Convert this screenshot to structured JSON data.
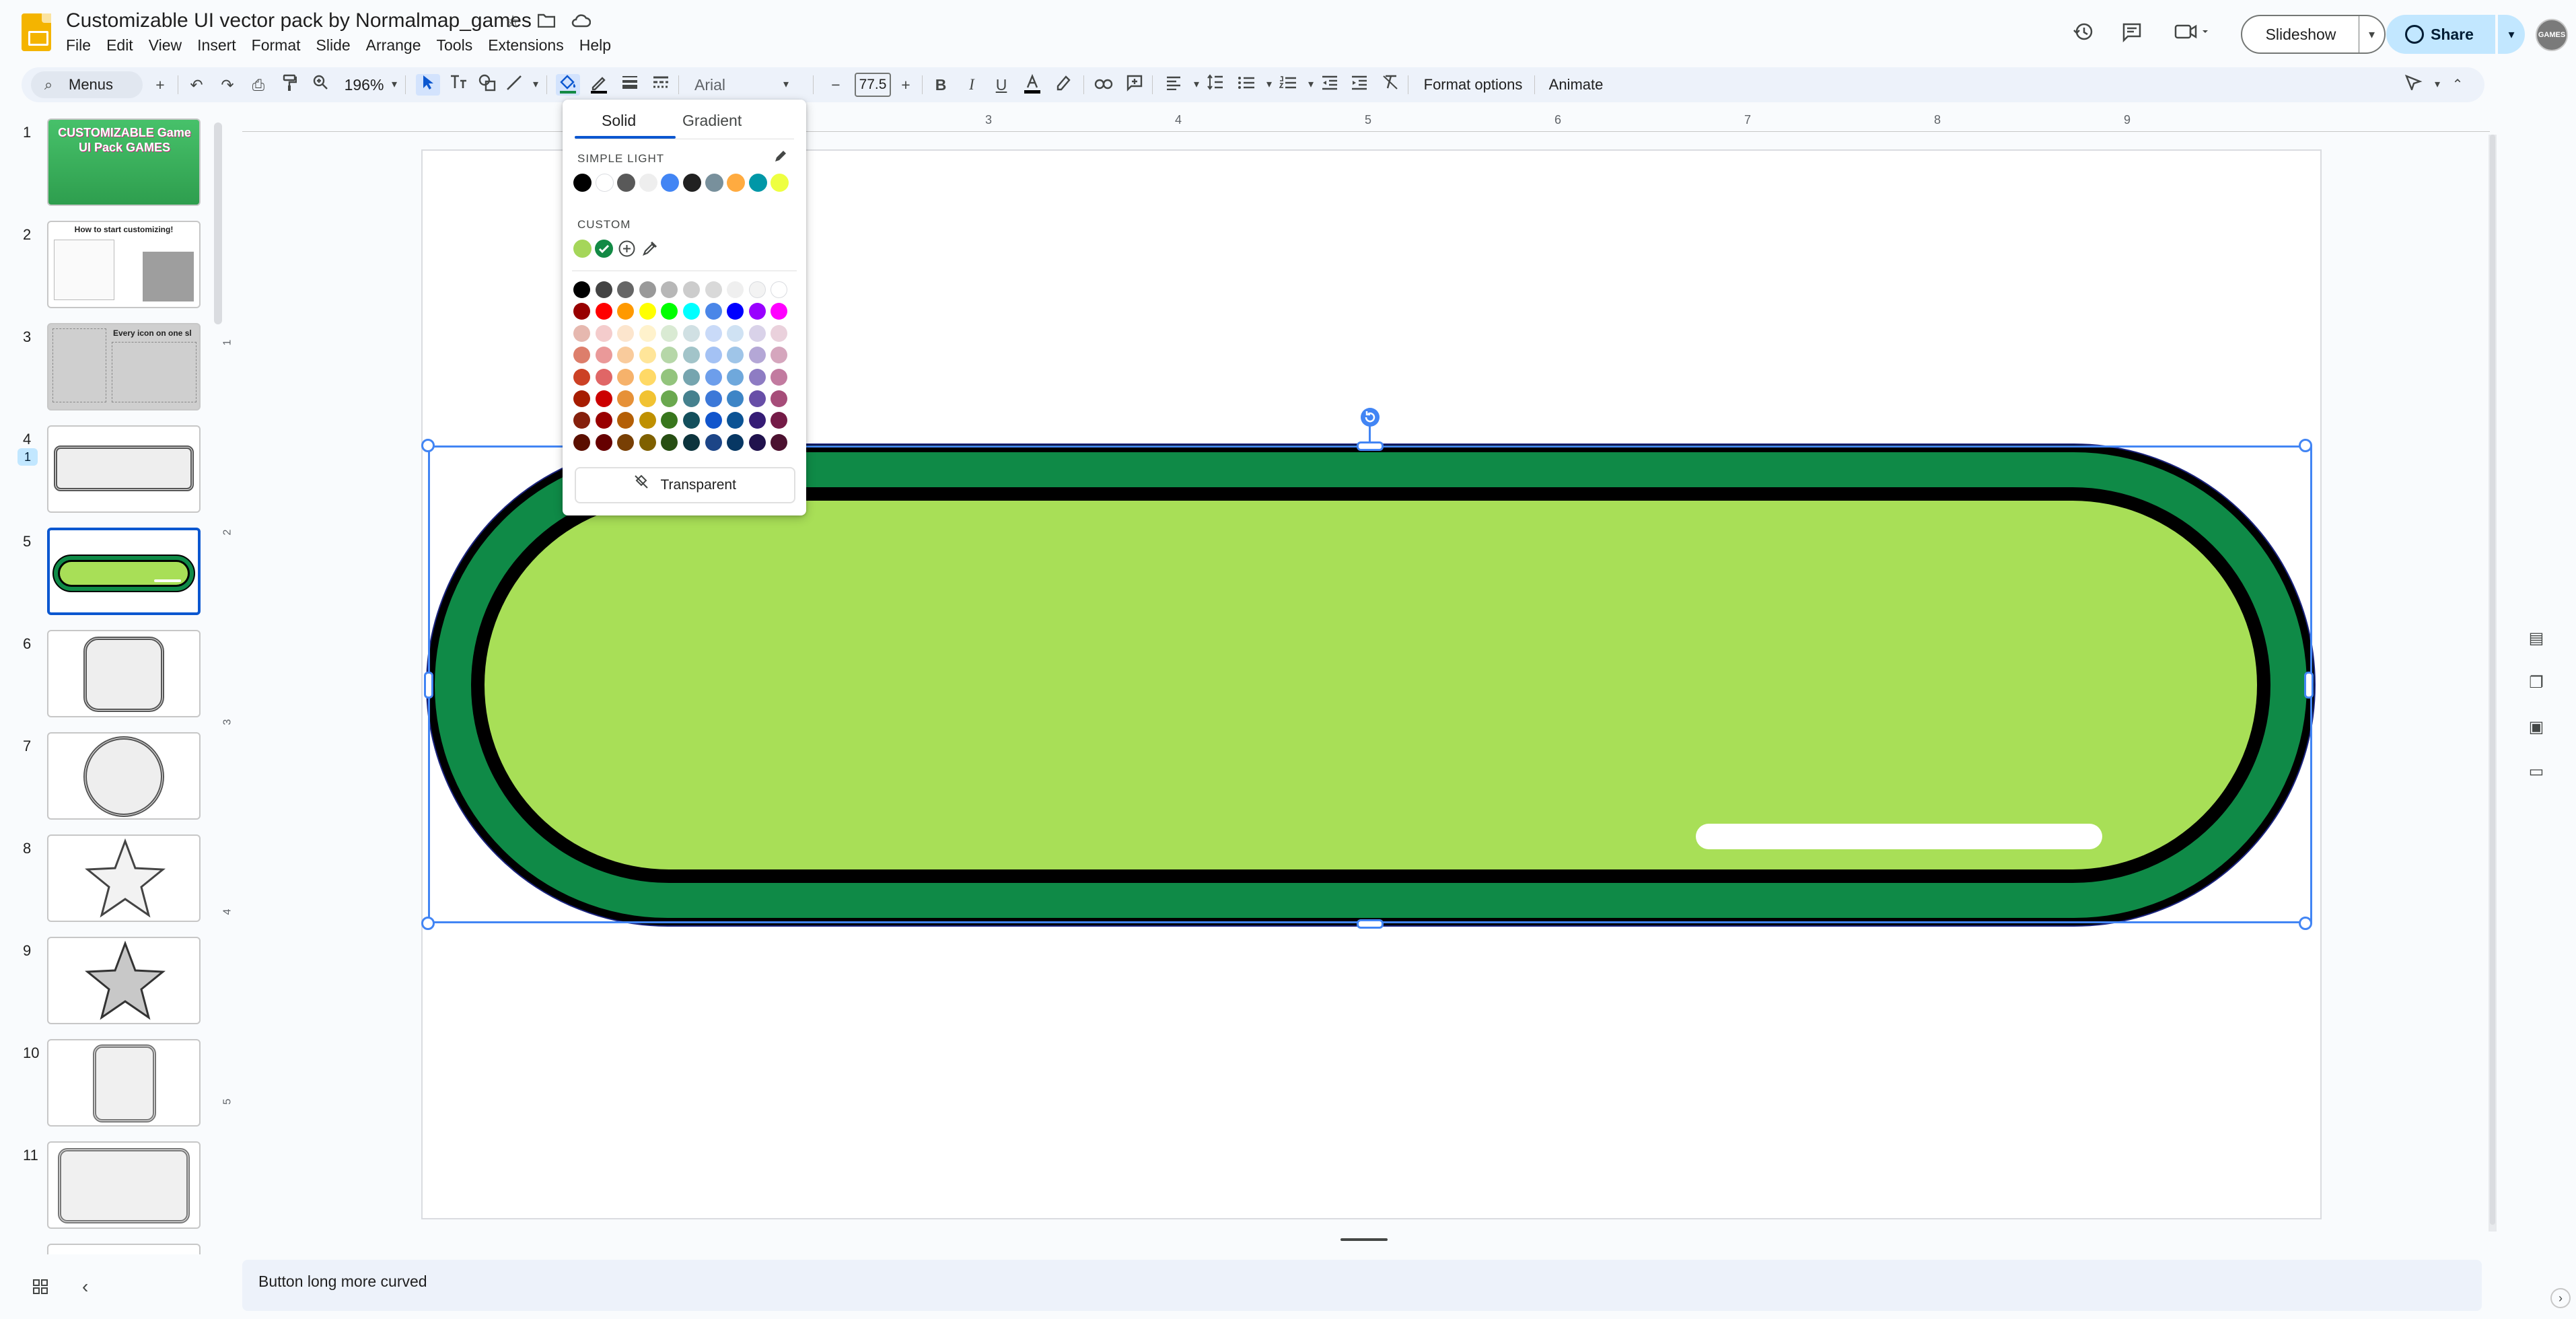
{
  "app": {
    "doc_title": "Customizable UI vector pack by Normalmap_games",
    "menu": [
      "File",
      "Edit",
      "View",
      "Insert",
      "Format",
      "Slide",
      "Arrange",
      "Tools",
      "Extensions",
      "Help"
    ]
  },
  "top_right": {
    "slideshow_label": "Slideshow",
    "share_label": "Share",
    "avatar_text": "GAMES"
  },
  "toolbar": {
    "search_label": "Menus",
    "zoom": "196%",
    "font": "Arial",
    "font_size": "77.5",
    "format_options": "Format options",
    "animate": "Animate"
  },
  "filmstrip": {
    "slides": [
      {
        "num": "1",
        "caption": "CUSTOMIZABLE Game UI Pack GAMES"
      },
      {
        "num": "2",
        "caption": "How to start customizing!"
      },
      {
        "num": "3",
        "caption": "Every icon on one sl"
      },
      {
        "num": "4"
      },
      {
        "num": "5"
      },
      {
        "num": "6"
      },
      {
        "num": "7"
      },
      {
        "num": "8"
      },
      {
        "num": "9"
      },
      {
        "num": "10"
      },
      {
        "num": "11"
      }
    ],
    "badge": "1"
  },
  "rulers": {
    "h": [
      "3",
      "4",
      "5",
      "6",
      "7",
      "8",
      "9"
    ],
    "v": [
      "1",
      "2",
      "3",
      "4",
      "5"
    ]
  },
  "fill_popup": {
    "tab_solid": "Solid",
    "tab_gradient": "Gradient",
    "theme_section": "SIMPLE LIGHT",
    "custom_section": "CUSTOM",
    "transparent_label": "Transparent",
    "theme_colors": [
      "#000000",
      "#ffffff",
      "#595959",
      "#eeeeee",
      "#4285f4",
      "#212121",
      "#78909c",
      "#ffab40",
      "#0097a7",
      "#eeff41"
    ],
    "custom_colors": [
      "#a5d65a",
      "#138a45"
    ],
    "palette": [
      [
        "#000000",
        "#434343",
        "#666666",
        "#999999",
        "#b7b7b7",
        "#cccccc",
        "#d9d9d9",
        "#efefef",
        "#f3f3f3",
        "#ffffff"
      ],
      [
        "#980000",
        "#ff0000",
        "#ff9900",
        "#ffff00",
        "#00ff00",
        "#00ffff",
        "#4a86e8",
        "#0000ff",
        "#9900ff",
        "#ff00ff"
      ],
      [
        "#e6b8af",
        "#f4cccc",
        "#fce5cd",
        "#fff2cc",
        "#d9ead3",
        "#d0e0e3",
        "#c9daf8",
        "#cfe2f3",
        "#d9d2e9",
        "#ead1dc"
      ],
      [
        "#dd7e6b",
        "#ea9999",
        "#f9cb9c",
        "#ffe599",
        "#b6d7a8",
        "#a2c4c9",
        "#a4c2f4",
        "#9fc5e8",
        "#b4a7d6",
        "#d5a6bd"
      ],
      [
        "#cc4125",
        "#e06666",
        "#f6b26b",
        "#ffd966",
        "#93c47d",
        "#76a5af",
        "#6d9eeb",
        "#6fa8dc",
        "#8e7cc3",
        "#c27ba0"
      ],
      [
        "#a61c00",
        "#cc0000",
        "#e69138",
        "#f1c232",
        "#6aa84f",
        "#45818e",
        "#3c78d8",
        "#3d85c6",
        "#674ea7",
        "#a64d79"
      ],
      [
        "#85200c",
        "#990000",
        "#b45f06",
        "#bf9000",
        "#38761d",
        "#134f5c",
        "#1155cc",
        "#0b5394",
        "#351c75",
        "#741b47"
      ],
      [
        "#5b0f00",
        "#660000",
        "#783f04",
        "#7f6000",
        "#274e13",
        "#0c343d",
        "#1c4587",
        "#073763",
        "#20124d",
        "#4c1130"
      ]
    ]
  },
  "shape": {
    "outer_fill": "#0f8a47",
    "outline": "#000000",
    "inner_fill": "#a8df57",
    "highlight": "#ffffff"
  },
  "notes": {
    "text": "Button long more curved"
  }
}
